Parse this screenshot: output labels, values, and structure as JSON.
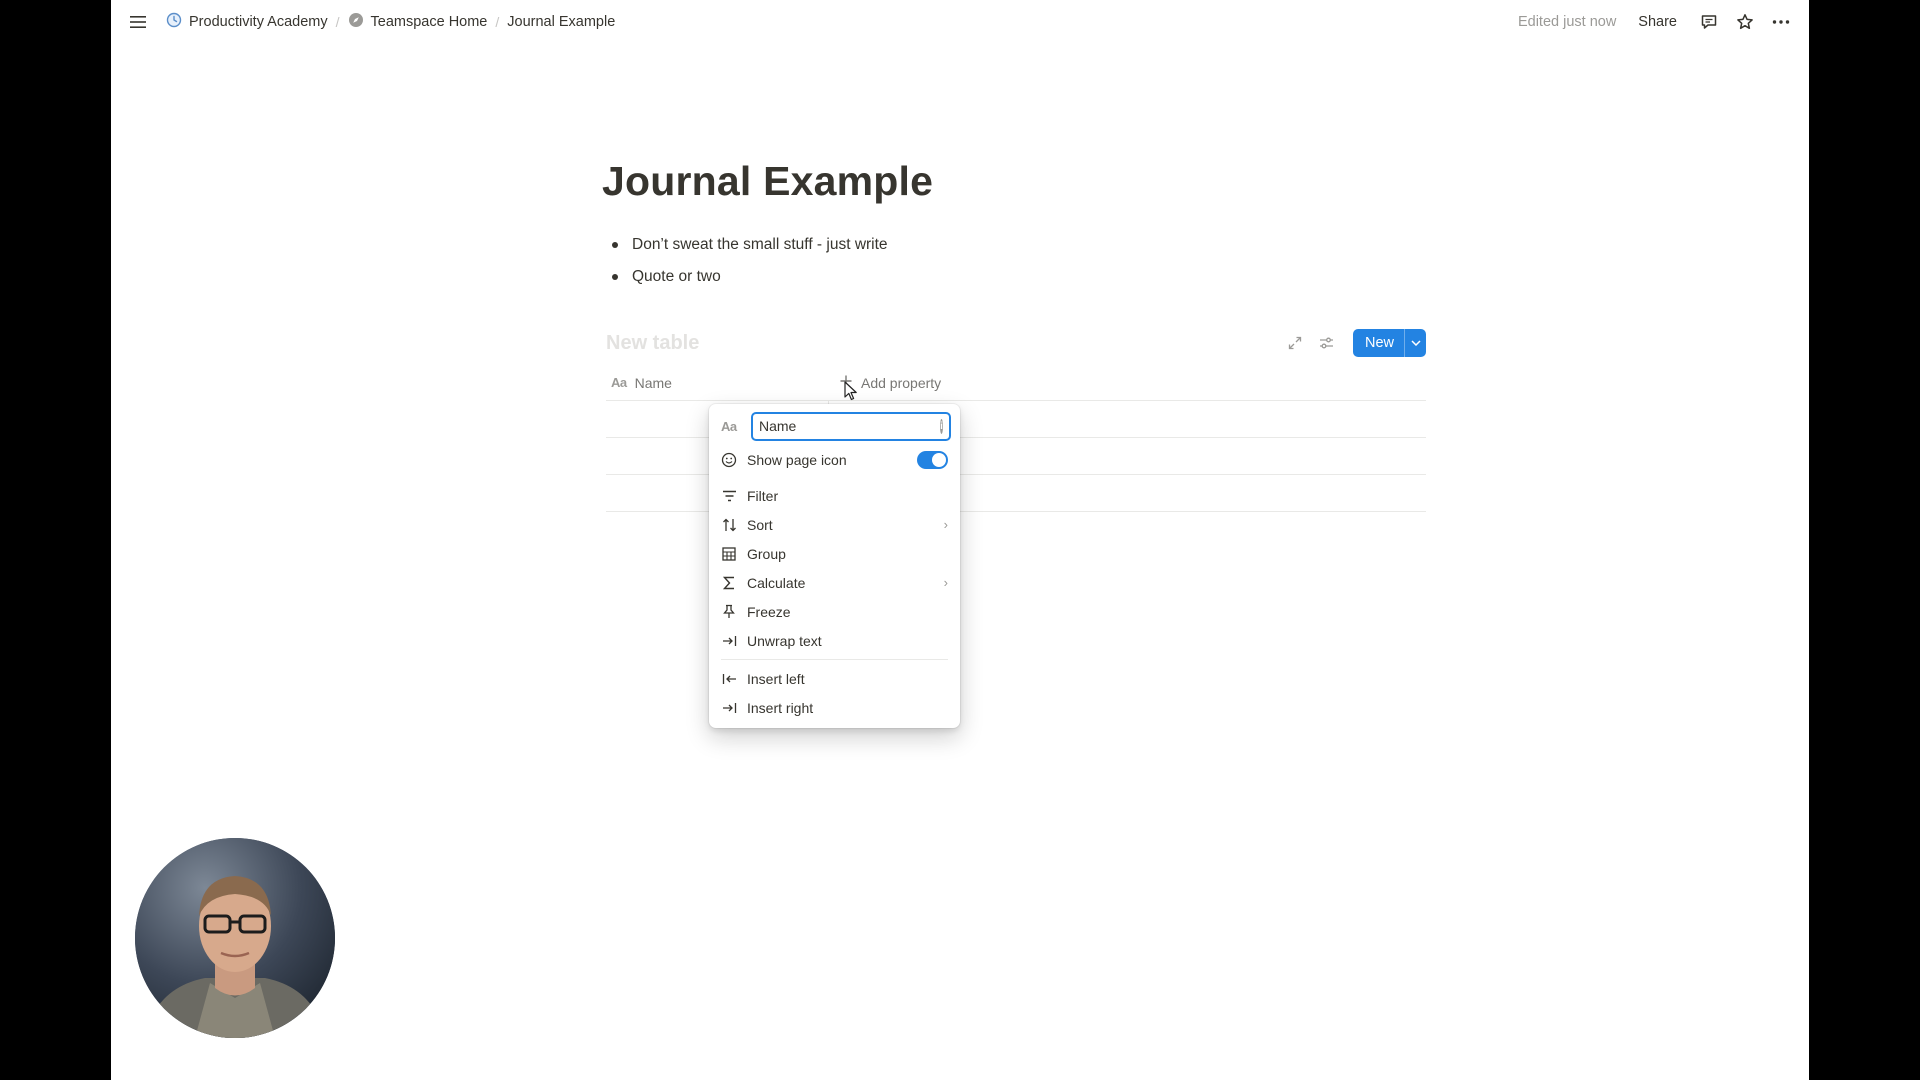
{
  "topbar": {
    "breadcrumbs": [
      {
        "label": "Productivity Academy",
        "icon": "clock-icon"
      },
      {
        "label": "Teamspace Home",
        "icon": "compass-icon"
      },
      {
        "label": "Journal Example",
        "icon": ""
      }
    ],
    "separator": "/",
    "edited": "Edited just now",
    "share_label": "Share"
  },
  "page": {
    "title": "Journal Example",
    "bullets": [
      "Don’t sweat the small stuff - just write",
      "Quote or two"
    ]
  },
  "database": {
    "title_placeholder": "New table",
    "new_label": "New",
    "columns": {
      "name_icon": "Aa",
      "name_label": "Name",
      "add_property_label": "Add property"
    }
  },
  "column_menu": {
    "name_icon": "Aa",
    "name_value": "Name",
    "show_page_icon_label": "Show page icon",
    "show_page_icon_on": true,
    "items": [
      {
        "label": "Filter",
        "icon": "filter-icon"
      },
      {
        "label": "Sort",
        "icon": "sort-icon",
        "submenu": true
      },
      {
        "label": "Group",
        "icon": "group-icon"
      },
      {
        "label": "Calculate",
        "icon": "sigma-icon",
        "submenu": true
      },
      {
        "label": "Freeze",
        "icon": "pin-icon"
      },
      {
        "label": "Unwrap text",
        "icon": "wrap-icon"
      }
    ],
    "insert_items": [
      {
        "label": "Insert left",
        "icon": "insert-left-icon"
      },
      {
        "label": "Insert right",
        "icon": "insert-right-icon"
      }
    ]
  },
  "colors": {
    "accent": "#2383e2",
    "text": "#37352f",
    "muted": "#9b9a97"
  }
}
